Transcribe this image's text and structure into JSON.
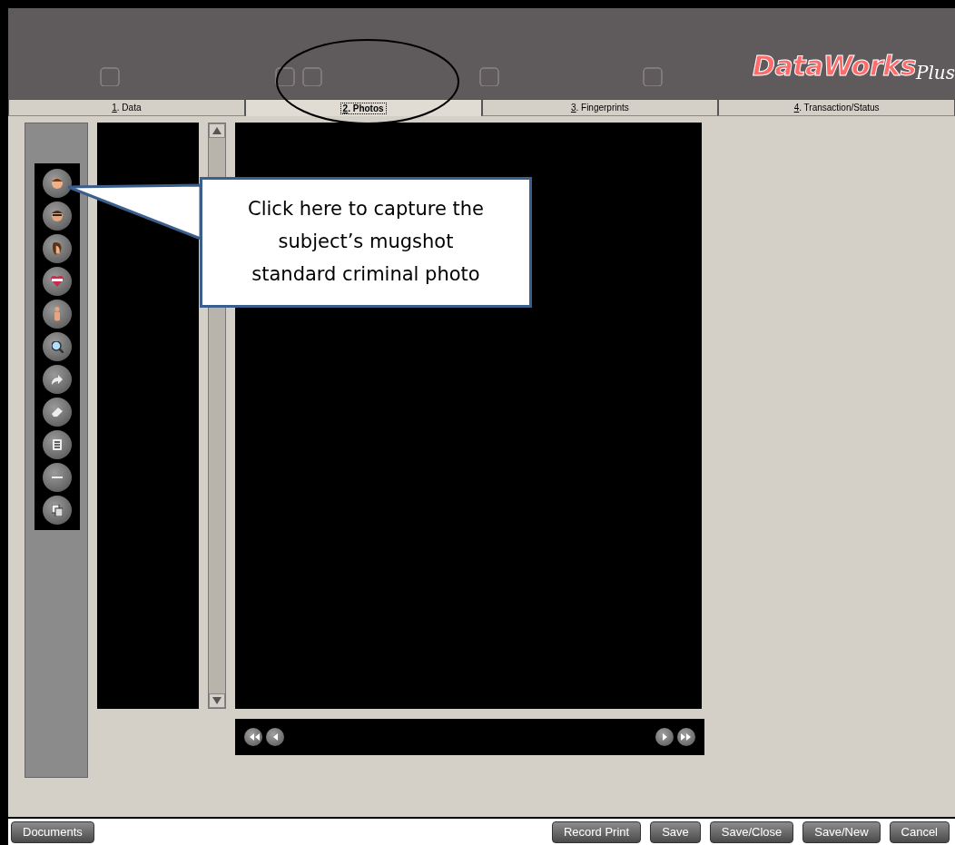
{
  "header": {
    "logo_main": "DataWorks",
    "logo_suffix": "Plus"
  },
  "tabs": [
    {
      "mnemonic": "1",
      "label": ". Data",
      "selected": false
    },
    {
      "mnemonic": "2",
      "label": ". Photos",
      "selected": true
    },
    {
      "mnemonic": "3",
      "label": ". Fingerprints",
      "selected": false
    },
    {
      "mnemonic": "4",
      "label": ". Transaction/Status",
      "selected": false
    }
  ],
  "toolbar": [
    {
      "kind": "face"
    },
    {
      "kind": "glasses"
    },
    {
      "kind": "profile"
    },
    {
      "kind": "heart"
    },
    {
      "kind": "body"
    },
    {
      "kind": "zoom"
    },
    {
      "kind": "rotate"
    },
    {
      "kind": "erase"
    },
    {
      "kind": "list"
    },
    {
      "kind": "minus"
    },
    {
      "kind": "copy"
    }
  ],
  "nav_buttons": [
    {
      "kind": "first"
    },
    {
      "kind": "prev"
    },
    {
      "kind": "next"
    },
    {
      "kind": "last"
    }
  ],
  "callout": {
    "text": "Click here to capture the subject’s mugshot standard criminal photo"
  },
  "footer": {
    "left_button": "Documents",
    "buttons": [
      "Record Print",
      "Save",
      "Save/Close",
      "Save/New",
      "Cancel"
    ]
  }
}
